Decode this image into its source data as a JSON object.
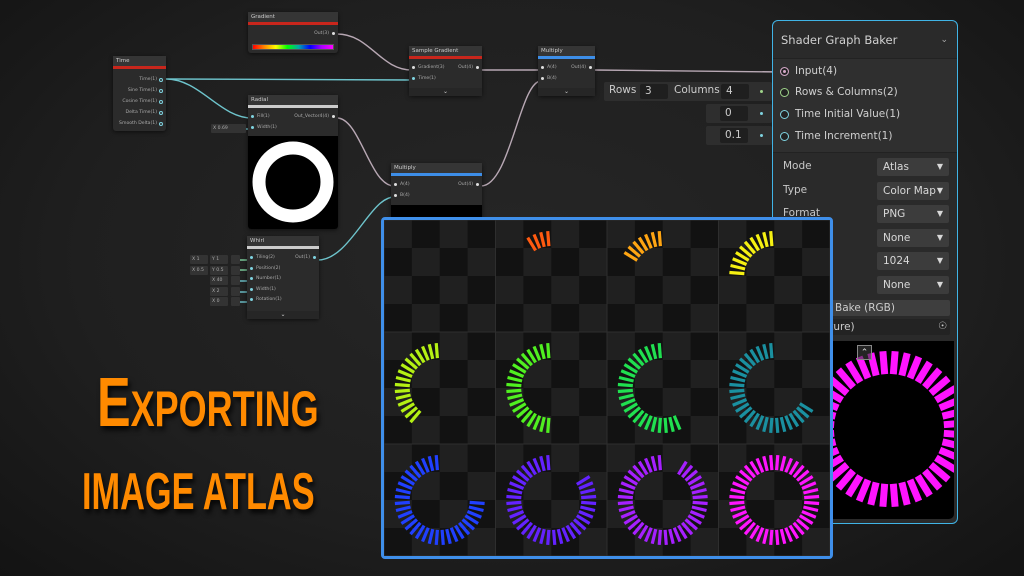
{
  "nodes": {
    "gradient": {
      "title": "Gradient",
      "out": "Out(3)",
      "color": "#c8261c"
    },
    "time": {
      "title": "Time",
      "outs": [
        "Time(1)",
        "Sine Time(1)",
        "Cosine Time(1)",
        "Delta Time(1)",
        "Smooth Delta(1)"
      ],
      "color": "#c8261c"
    },
    "sample_gradient": {
      "title": "Sample Gradient",
      "ins": [
        "Gradient(3)",
        "Time(1)"
      ],
      "out": "Out(4)",
      "color": "#c8261c"
    },
    "radial": {
      "title": "Radial",
      "ins": [
        "Fill(1)",
        "Width(1)"
      ],
      "out": "Out_Vector4(4)",
      "width_input": {
        "axis": "X",
        "value": "0.69"
      },
      "color": "#cccccc"
    },
    "multiply_top": {
      "title": "Multiply",
      "ins": [
        "A(4)",
        "B(4)"
      ],
      "out": "Out(4)",
      "color": "#3d8ee8"
    },
    "multiply_mid": {
      "title": "Multiply",
      "ins": [
        "A(4)",
        "B(4)"
      ],
      "out": "Out(4)",
      "color": "#3d8ee8"
    },
    "whirl": {
      "title": "Whirl",
      "ins": [
        "Tiling(2)",
        "Position(2)",
        "Number(1)",
        "Width(1)",
        "Rotation(1)"
      ],
      "out": "Out(1)",
      "color": "#cccccc",
      "inputs": [
        [
          {
            "axis": "X",
            "value": "1"
          },
          {
            "axis": "Y",
            "value": "1"
          }
        ],
        [
          {
            "axis": "X",
            "value": "0.5"
          },
          {
            "axis": "Y",
            "value": "0.5"
          }
        ],
        [
          {
            "axis": "X",
            "value": "40"
          }
        ],
        [
          {
            "axis": "X",
            "value": "2"
          }
        ],
        [
          {
            "axis": "X",
            "value": "0"
          }
        ]
      ]
    }
  },
  "baker": {
    "title": "Shader Graph Baker",
    "ports": [
      "Input(4)",
      "Rows & Columns(2)",
      "Time Initial Value(1)",
      "Time Increment(1)"
    ],
    "rows_label": "Rows",
    "rows_value": "3",
    "columns_label": "Columns",
    "columns_value": "4",
    "time_initial": "0",
    "time_increment": "0.1",
    "settings": [
      {
        "label": "Mode",
        "value": "Atlas"
      },
      {
        "label": "Type",
        "value": "Color Map"
      },
      {
        "label": "Format",
        "value": "PNG"
      },
      {
        "label": "",
        "value": "None"
      },
      {
        "label": "",
        "value": "1024"
      },
      {
        "label": "",
        "value": "None"
      }
    ],
    "bake_button": "Bake (RGB)",
    "texture_field": "xture)",
    "accent": "#40b4e6"
  },
  "atlas": {
    "rows": 3,
    "columns": 4,
    "ticks": 40,
    "frames": [
      {
        "fill": 0.0,
        "color": "#ff3010"
      },
      {
        "fill": 0.1,
        "color": "#ff5a10"
      },
      {
        "fill": 0.18,
        "color": "#ffa512"
      },
      {
        "fill": 0.26,
        "color": "#f5f012"
      },
      {
        "fill": 0.4,
        "color": "#b4f014"
      },
      {
        "fill": 0.5,
        "color": "#50f020"
      },
      {
        "fill": 0.58,
        "color": "#20e050"
      },
      {
        "fill": 0.68,
        "color": "#1a90a0"
      },
      {
        "fill": 0.76,
        "color": "#2040ff"
      },
      {
        "fill": 0.84,
        "color": "#6422ff"
      },
      {
        "fill": 0.92,
        "color": "#a620ff"
      },
      {
        "fill": 1.0,
        "color": "#ff14ff"
      }
    ],
    "border": "#3f8fea"
  },
  "headline": {
    "line1_first": "E",
    "line1_rest": "XPORTING",
    "line2": "IMAGE ATLAS",
    "color": "#ff8a00"
  }
}
